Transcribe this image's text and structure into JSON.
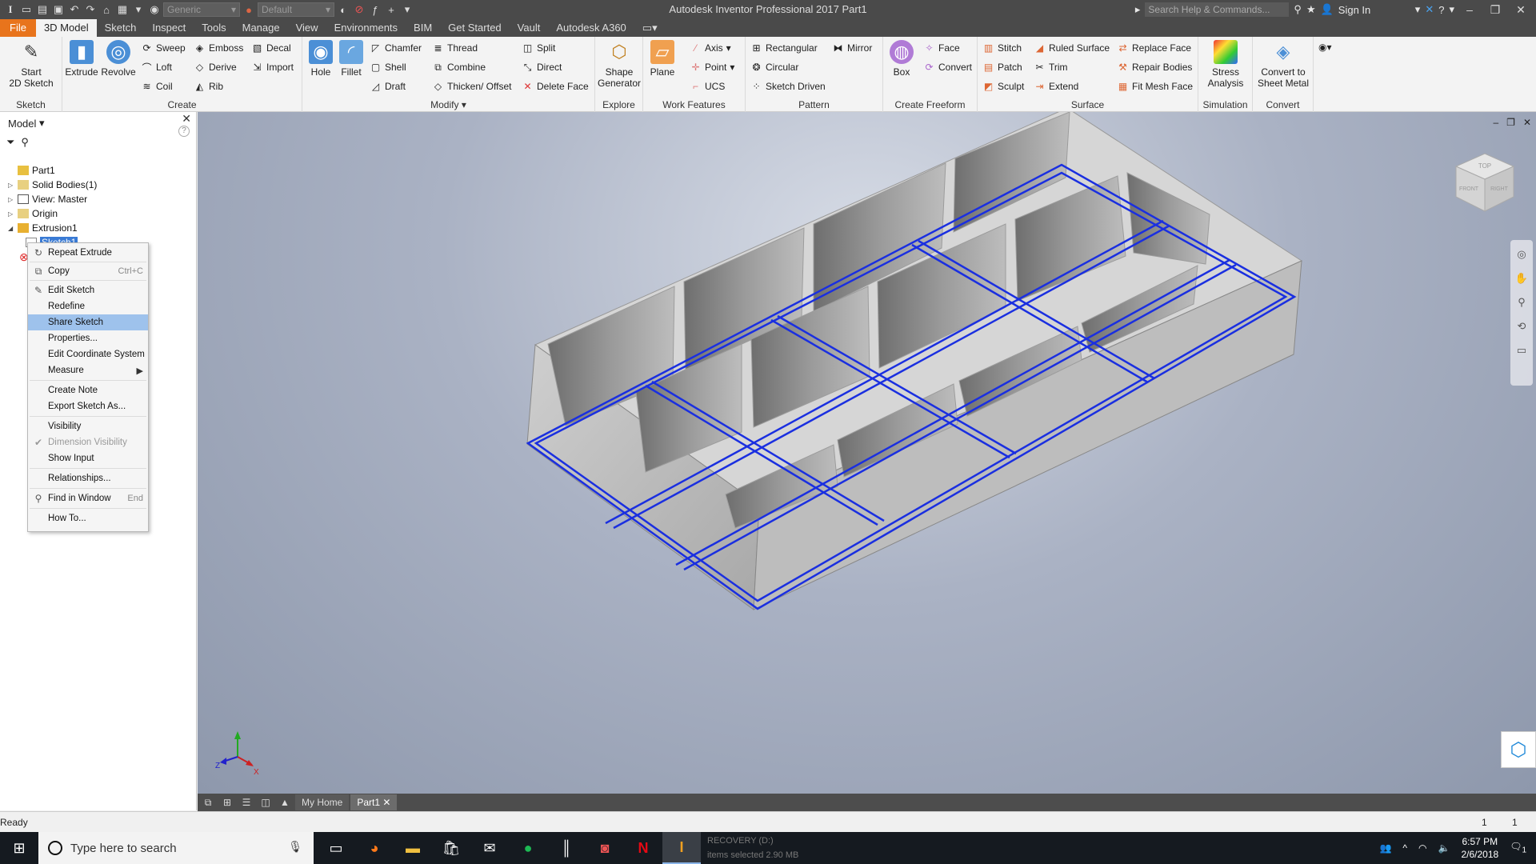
{
  "titlebar": {
    "appicon": "I",
    "material": "Generic",
    "appearance": "Default",
    "title": "Autodesk Inventor Professional 2017   Part1",
    "search_placeholder": "Search Help & Commands...",
    "signin": "Sign In"
  },
  "tabs": [
    "File",
    "3D Model",
    "Sketch",
    "Inspect",
    "Tools",
    "Manage",
    "View",
    "Environments",
    "BIM",
    "Get Started",
    "Vault",
    "Autodesk A360"
  ],
  "ribbon": {
    "sketch": {
      "label": "Sketch",
      "start": "Start",
      "start2": "2D Sketch"
    },
    "create": {
      "label": "Create",
      "extrude": "Extrude",
      "revolve": "Revolve",
      "sweep": "Sweep",
      "loft": "Loft",
      "coil": "Coil",
      "emboss": "Emboss",
      "derive": "Derive",
      "rib": "Rib",
      "decal": "Decal",
      "import": "Import"
    },
    "modify": {
      "label": "Modify",
      "hole": "Hole",
      "fillet": "Fillet",
      "chamfer": "Chamfer",
      "shell": "Shell",
      "draft": "Draft",
      "thread": "Thread",
      "combine": "Combine",
      "thicken": "Thicken/ Offset",
      "split": "Split",
      "direct": "Direct",
      "deleteface": "Delete Face"
    },
    "explore": {
      "label": "Explore",
      "shape": "Shape",
      "shape2": "Generator"
    },
    "work": {
      "label": "Work Features",
      "plane": "Plane",
      "axis": "Axis",
      "point": "Point",
      "ucs": "UCS"
    },
    "pattern": {
      "label": "Pattern",
      "rectangular": "Rectangular",
      "circular": "Circular",
      "sketchdriven": "Sketch Driven",
      "mirror": "Mirror"
    },
    "freeform": {
      "label": "Create Freeform",
      "box": "Box",
      "face": "Face",
      "convert": "Convert"
    },
    "surface": {
      "label": "Surface",
      "stitch": "Stitch",
      "patch": "Patch",
      "sculpt": "Sculpt",
      "ruled": "Ruled Surface",
      "trim": "Trim",
      "extend": "Extend",
      "replace": "Replace Face",
      "repair": "Repair Bodies",
      "fitmesh": "Fit Mesh Face"
    },
    "simulation": {
      "label": "Simulation",
      "stress": "Stress",
      "stress2": "Analysis"
    },
    "convert": {
      "label": "Convert",
      "sheet": "Convert to",
      "sheet2": "Sheet Metal"
    }
  },
  "browser": {
    "title": "Model",
    "tree": [
      {
        "label": "Part1",
        "indent": 0,
        "toggle": ""
      },
      {
        "label": "Solid Bodies(1)",
        "indent": 0,
        "toggle": "▷"
      },
      {
        "label": "View: Master",
        "indent": 0,
        "toggle": "▷"
      },
      {
        "label": "Origin",
        "indent": 0,
        "toggle": "▷"
      },
      {
        "label": "Extrusion1",
        "indent": 0,
        "toggle": "◢"
      },
      {
        "label": "Sketch1",
        "indent": 1,
        "toggle": ""
      }
    ]
  },
  "context_menu": {
    "items": [
      {
        "label": "Repeat Extrude",
        "shortcut": "",
        "icon": "repeat-icon"
      },
      {
        "label": "Copy",
        "shortcut": "Ctrl+C",
        "icon": "copy-icon"
      },
      {
        "label": "Edit Sketch",
        "shortcut": "",
        "icon": "edit-sketch-icon"
      },
      {
        "label": "Redefine",
        "shortcut": ""
      },
      {
        "label": "Share Sketch",
        "shortcut": ""
      },
      {
        "label": "Properties...",
        "shortcut": ""
      },
      {
        "label": "Edit Coordinate System",
        "shortcut": ""
      },
      {
        "label": "Measure",
        "shortcut": ""
      },
      {
        "label": "Create Note",
        "shortcut": ""
      },
      {
        "label": "Export Sketch As...",
        "shortcut": ""
      },
      {
        "label": "Visibility",
        "shortcut": ""
      },
      {
        "label": "Dimension Visibility",
        "shortcut": "",
        "disabled": true,
        "checked": true
      },
      {
        "label": "Show Input",
        "shortcut": ""
      },
      {
        "label": "Relationships...",
        "shortcut": ""
      },
      {
        "label": "Find in Window",
        "shortcut": "End",
        "icon": "find-icon"
      },
      {
        "label": "How To...",
        "shortcut": ""
      }
    ],
    "highlighted": "Share Sketch"
  },
  "viewcube": {
    "top": "TOP",
    "front": "FRONT",
    "right": "RIGHT"
  },
  "doctabs": {
    "home": "My Home",
    "part": "Part1"
  },
  "status": {
    "ready": "Ready",
    "n1": "1",
    "n2": "1"
  },
  "taskbar": {
    "search_placeholder": "Type here to search",
    "time": "6:57 PM",
    "date": "2/6/2018",
    "ghost1": "RECOVERY (D:)",
    "ghost2": "items selected  2.90 MB",
    "notif": "1"
  },
  "colors": {
    "accent_file": "#e8741c",
    "sketch_line": "#1a2fe0",
    "selection": "#9ec2ec"
  }
}
